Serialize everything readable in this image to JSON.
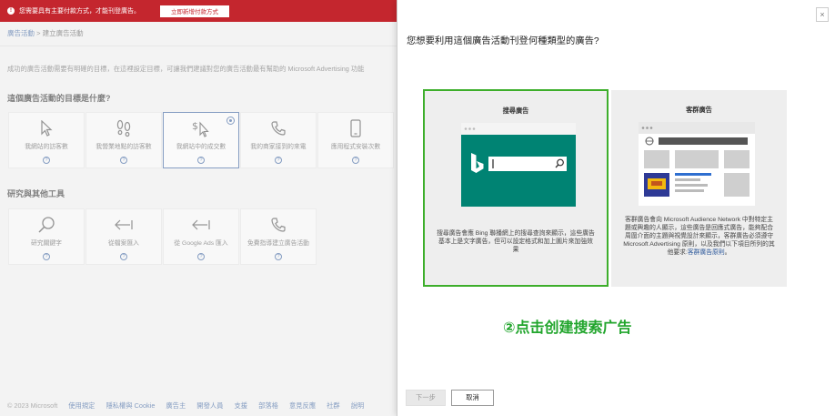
{
  "banner": {
    "message": "您需要具有主要付款方式，才能刊登廣告。",
    "button": "立即新增付款方式"
  },
  "breadcrumb": {
    "root": "廣告活動",
    "separator": ">",
    "current": "建立廣告活動"
  },
  "intro": "成功的廣告活動需要有明確的目標，在這裡設定目標，可讓我們建議對您的廣告活動最有幫助的 Microsoft Advertising 功能",
  "goals": {
    "title": "這個廣告活動的目標是什麼?",
    "items": [
      {
        "label": "我網站的訪客數",
        "icon": "cursor-icon"
      },
      {
        "label": "我營業地點的訪客數",
        "icon": "footprints-icon"
      },
      {
        "label": "我網站中的成交數",
        "icon": "dollar-cursor-icon",
        "selected": true
      },
      {
        "label": "我的商家接到的來電",
        "icon": "phone-icon"
      },
      {
        "label": "應用程式安裝次數",
        "icon": "mobile-icon"
      }
    ]
  },
  "tools": {
    "title": "研究與其他工具",
    "items": [
      {
        "label": "研究關鍵字",
        "icon": "search-icon"
      },
      {
        "label": "從檔案匯入",
        "icon": "import-arrow-icon"
      },
      {
        "label": "從 Google Ads 匯入",
        "icon": "import-arrow-icon"
      },
      {
        "label": "免費指導建立廣告活動",
        "icon": "phone-icon"
      }
    ]
  },
  "footer": {
    "copyright": "© 2023 Microsoft",
    "links": [
      "使用規定",
      "隱私權與 Cookie",
      "廣告主",
      "開發人員",
      "支援",
      "部落格",
      "意見反應",
      "社群",
      "說明"
    ]
  },
  "panel": {
    "question": "您想要利用這個廣告活動刊登何種類型的廣告?",
    "close_glyph": "×",
    "search_card": {
      "title": "搜尋廣告",
      "description": "搜尋廣告會應 Bing 聯播網上的搜尋查詢來顯示，這些廣告基本上是文字廣告，但可以設定格式和加上圖片來加強效果",
      "brand_color": "#008373",
      "selected_border": "#3dae2b"
    },
    "audience_card": {
      "title": "客群廣告",
      "description": "客群廣告會向 Microsoft Audience Network 中對特定主題或興趣的人顯示，這些廣告是回應式廣告，能夠配合周圍介面的主題與視覺設計來顯示，客群廣告必須遵守 Microsoft Advertising 原則，以及我們以下項目所列的其他要求:",
      "link": "客群廣告原則",
      "link_suffix": "。"
    },
    "annotation": "②点击创建搜索广告",
    "buttons": {
      "next": "下一步",
      "cancel": "取消"
    }
  }
}
